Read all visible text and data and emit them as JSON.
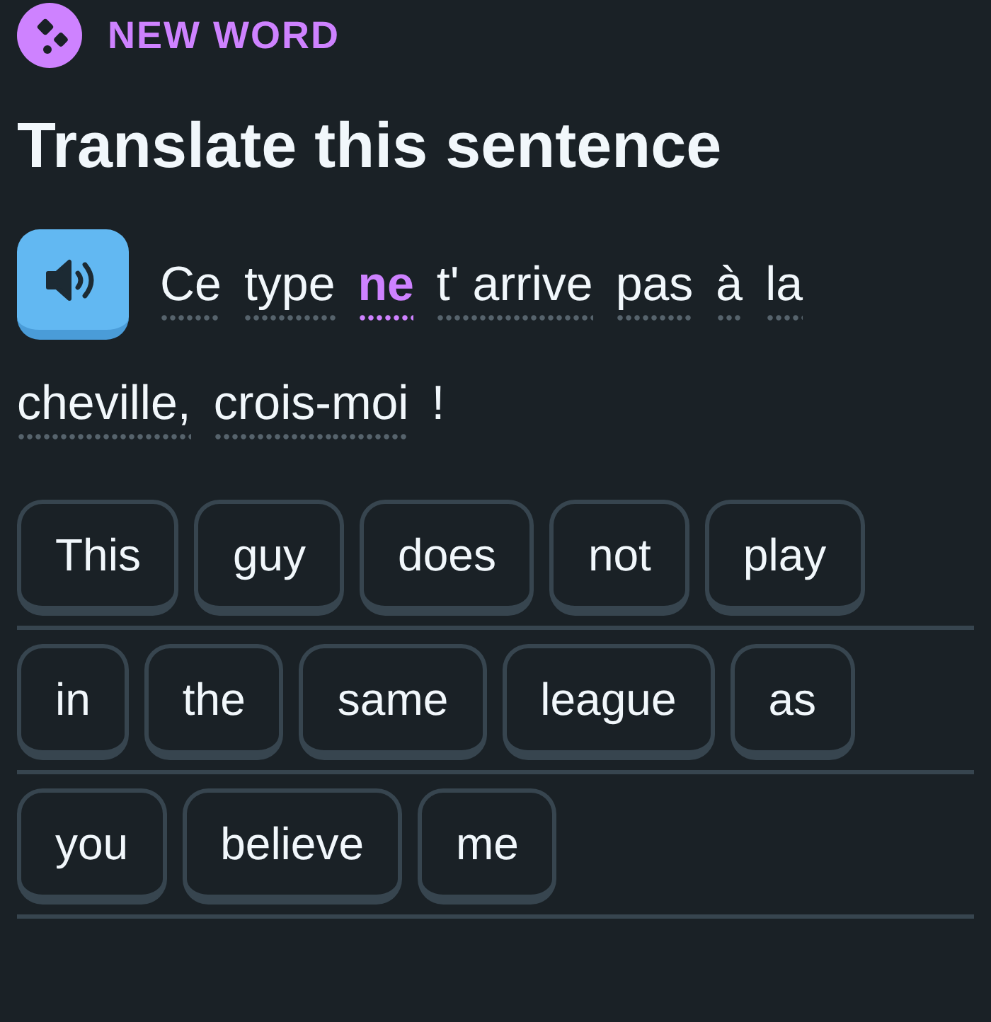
{
  "header": {
    "badge": {
      "label": "NEW WORD"
    }
  },
  "title": "Translate this sentence",
  "sentence": {
    "tokens": [
      {
        "text": "Ce",
        "hint": true,
        "new": false,
        "joined": false
      },
      {
        "text": "type",
        "hint": true,
        "new": false,
        "joined": false
      },
      {
        "text": "ne",
        "hint": true,
        "new": true,
        "joined": false
      },
      {
        "text": "t' arrive",
        "hint": true,
        "new": false,
        "joined": false
      },
      {
        "text": "pas",
        "hint": true,
        "new": false,
        "joined": false
      },
      {
        "text": "à",
        "hint": true,
        "new": false,
        "joined": false
      },
      {
        "text": "la",
        "hint": true,
        "new": false,
        "joined": false
      },
      {
        "text": "cheville,",
        "hint": true,
        "new": false,
        "joined": false
      },
      {
        "text": "crois-",
        "hint": true,
        "new": false,
        "joined": false
      },
      {
        "text": "moi",
        "hint": true,
        "new": false,
        "joined": true
      },
      {
        "text": "!",
        "hint": false,
        "new": false,
        "joined": false
      }
    ]
  },
  "answer_lines": [
    {
      "tiles": [
        "This",
        "guy",
        "does",
        "not",
        "play"
      ]
    },
    {
      "tiles": [
        "in",
        "the",
        "same",
        "league",
        "as"
      ]
    },
    {
      "tiles": [
        "you",
        "believe",
        "me"
      ]
    }
  ]
}
